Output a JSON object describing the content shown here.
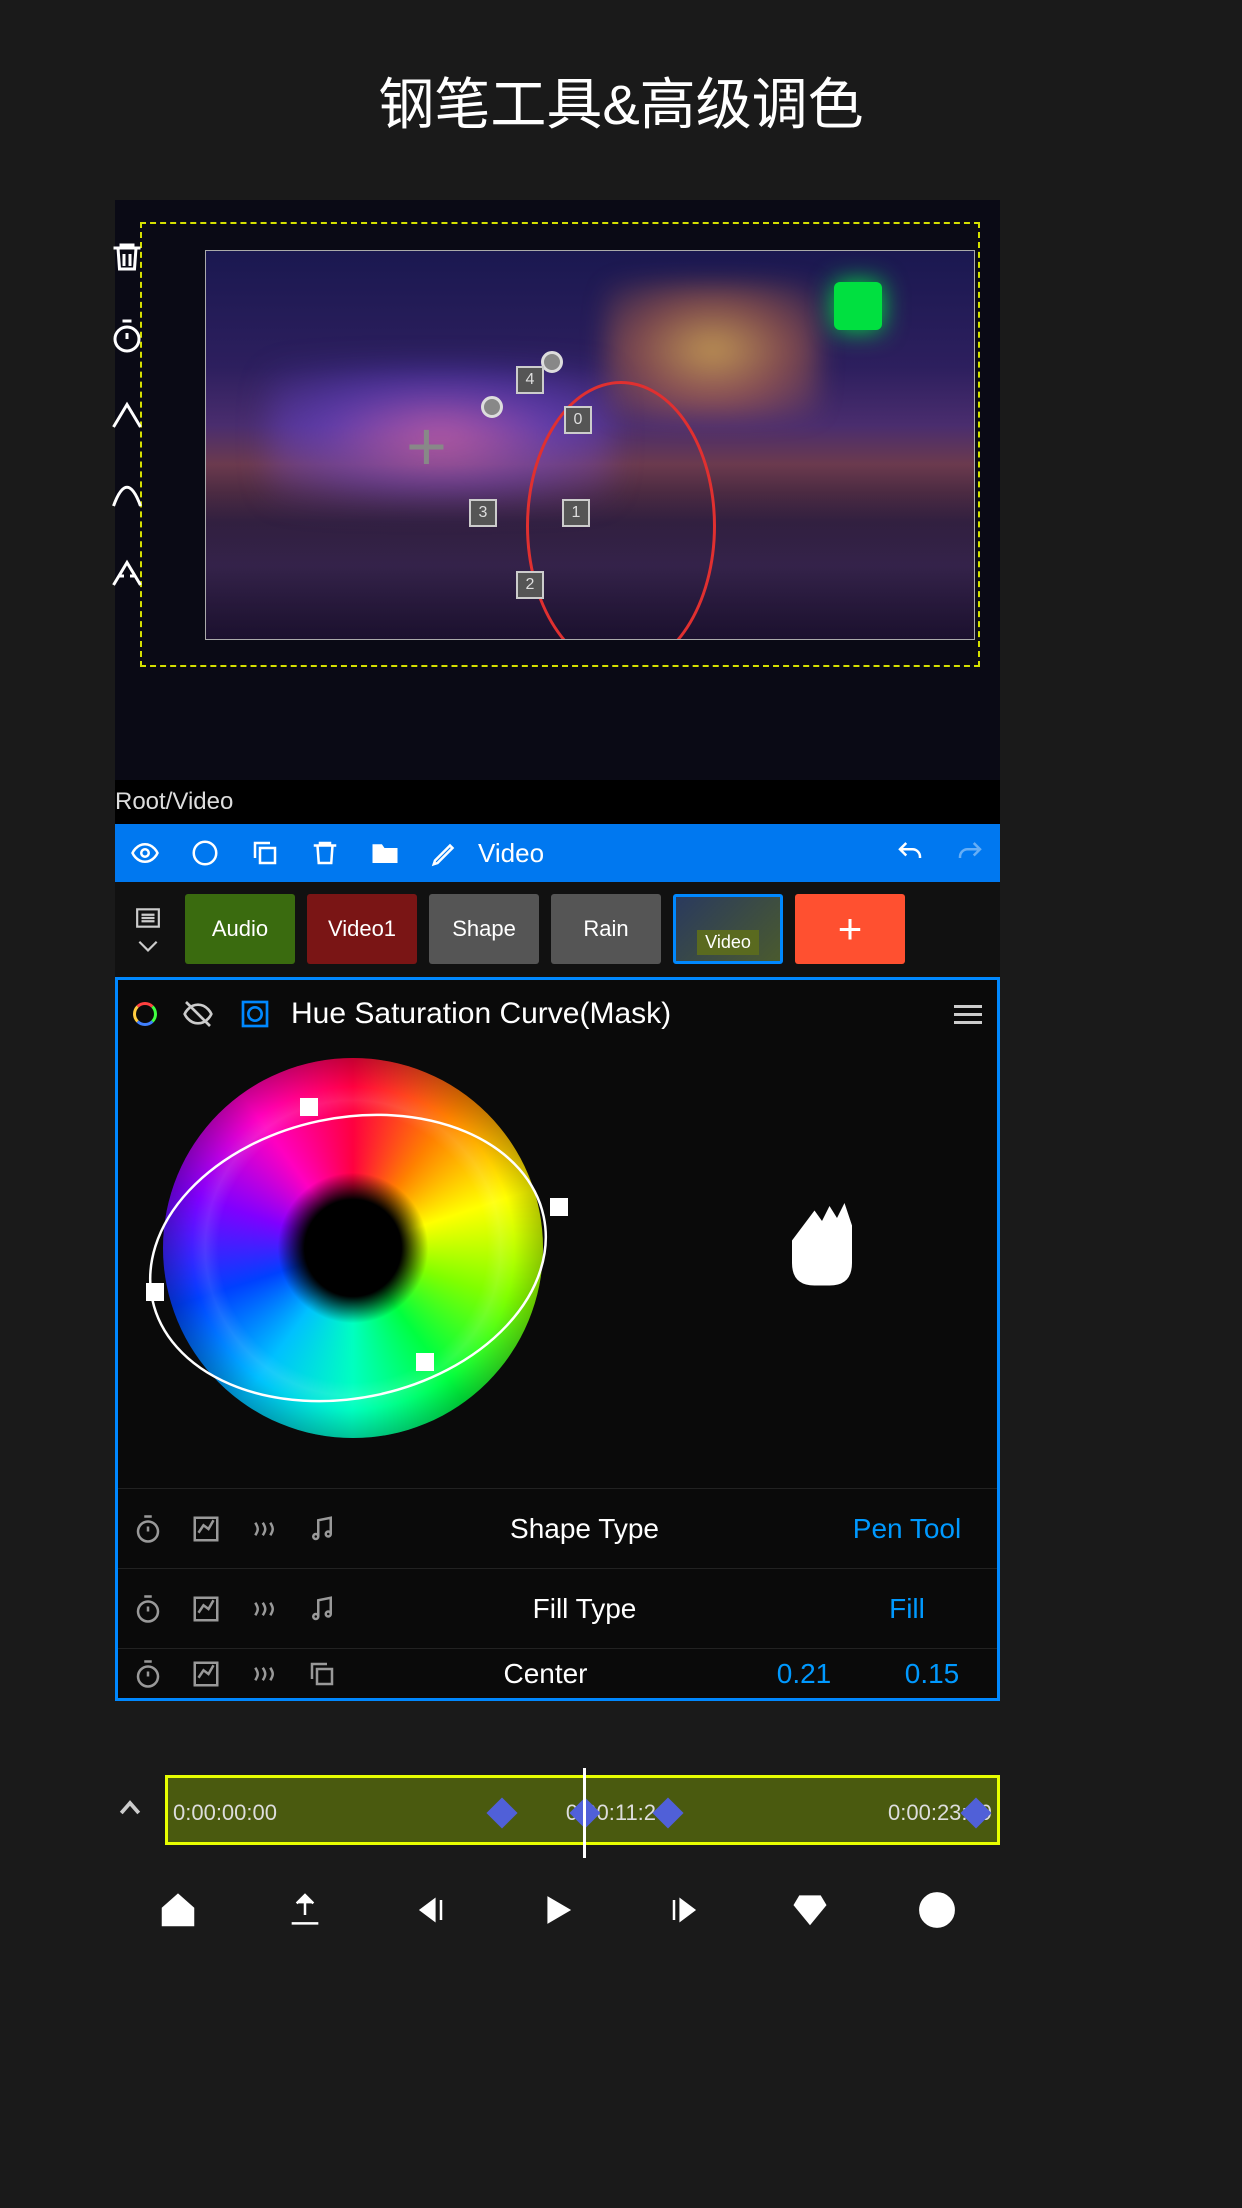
{
  "title": "钢笔工具&高级调色",
  "breadcrumb": "Root/Video",
  "toolbar": {
    "edit_label": "Video"
  },
  "mask_points": [
    "0",
    "1",
    "2",
    "3",
    "4"
  ],
  "tracks": [
    {
      "label": "Audio",
      "type": "green"
    },
    {
      "label": "Video1",
      "type": "red"
    },
    {
      "label": "Shape",
      "type": "gray"
    },
    {
      "label": "Rain",
      "type": "gray"
    },
    {
      "label": "Video",
      "type": "thumb"
    }
  ],
  "add_label": "+",
  "panel": {
    "title": "Hue Saturation Curve(Mask)"
  },
  "params": [
    {
      "label": "Shape Type",
      "value": "Pen Tool"
    },
    {
      "label": "Fill Type",
      "value": "Fill"
    },
    {
      "label": "Center",
      "value": "0.21",
      "value2": "0.15"
    }
  ],
  "timeline": {
    "start": "0:00:00:00",
    "mid": "0:00:11:24",
    "end": "0:00:23:19"
  }
}
